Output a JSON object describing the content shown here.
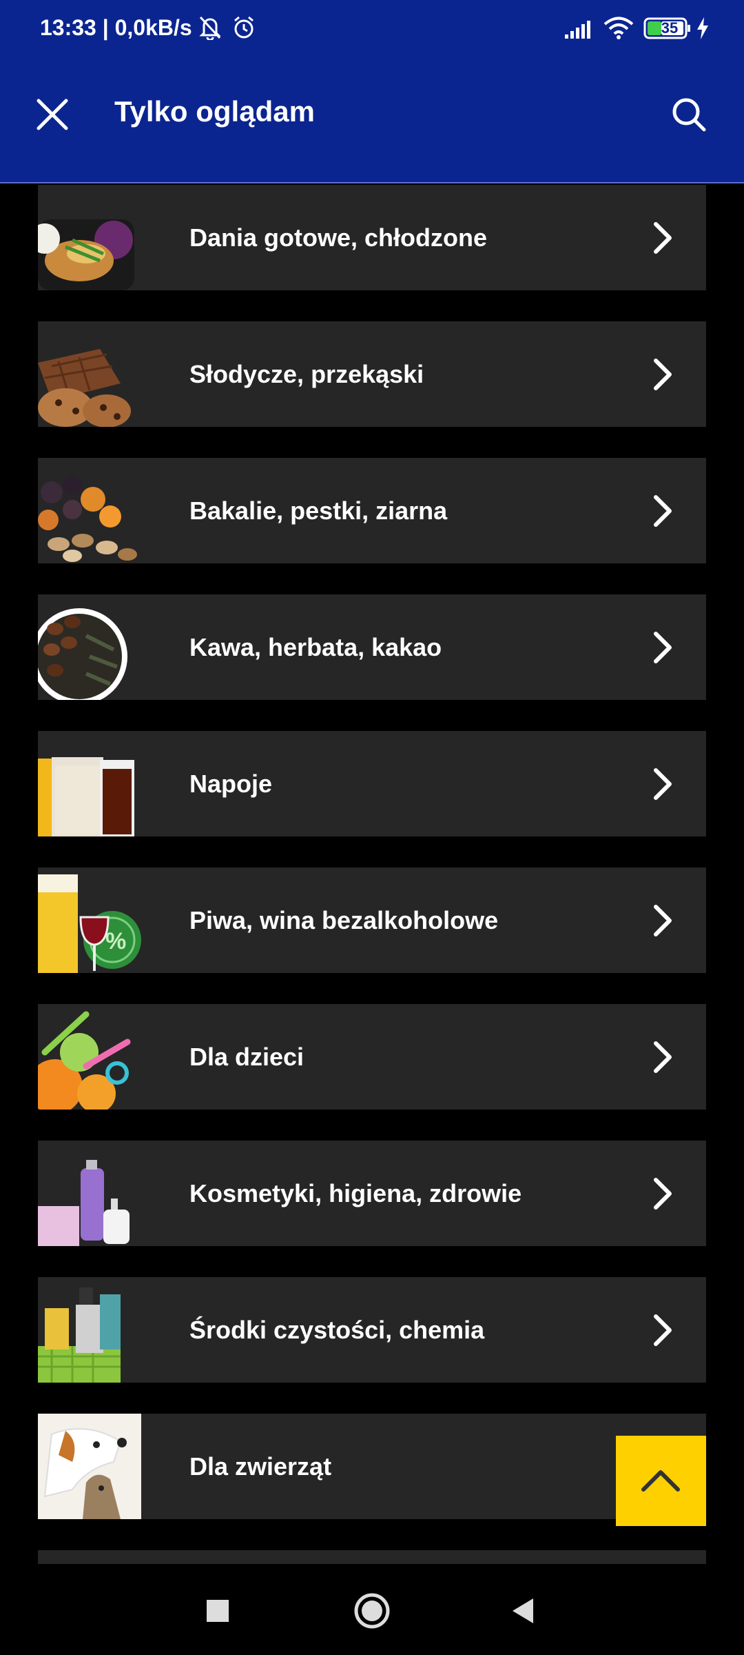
{
  "status_bar": {
    "time": "13:33 | 0,0kB/s",
    "battery": "35",
    "icons": [
      "mute-bell-icon",
      "alarm-icon",
      "signal-icon",
      "wifi-icon",
      "battery-icon",
      "charging-icon"
    ]
  },
  "app_bar": {
    "title": "Tylko oglądam",
    "close_icon": "close-icon",
    "search_icon": "search-icon",
    "background": "#0b2590"
  },
  "categories": [
    {
      "label": "Dania gotowe, chłodzone",
      "icon": "ready-meal-thumbnail"
    },
    {
      "label": "Słodycze, przekąski",
      "icon": "sweets-thumbnail"
    },
    {
      "label": "Bakalie, pestki, ziarna",
      "icon": "nuts-thumbnail"
    },
    {
      "label": "Kawa, herbata, kakao",
      "icon": "coffee-thumbnail"
    },
    {
      "label": "Napoje",
      "icon": "drinks-thumbnail"
    },
    {
      "label": "Piwa, wina bezalkoholowe",
      "icon": "beer-wine-thumbnail"
    },
    {
      "label": "Dla dzieci",
      "icon": "baby-thumbnail"
    },
    {
      "label": "Kosmetyki, higiena, zdrowie",
      "icon": "cosmetics-thumbnail"
    },
    {
      "label": "Środki czystości, chemia",
      "icon": "cleaning-thumbnail"
    },
    {
      "label": "Dla zwierząt",
      "icon": "pets-thumbnail"
    }
  ],
  "scroll_top_button": {
    "icon": "chevron-up-icon",
    "color": "#ffd000"
  },
  "nav_bar": {
    "icons": [
      "recent-apps-icon",
      "home-icon",
      "back-icon"
    ]
  }
}
